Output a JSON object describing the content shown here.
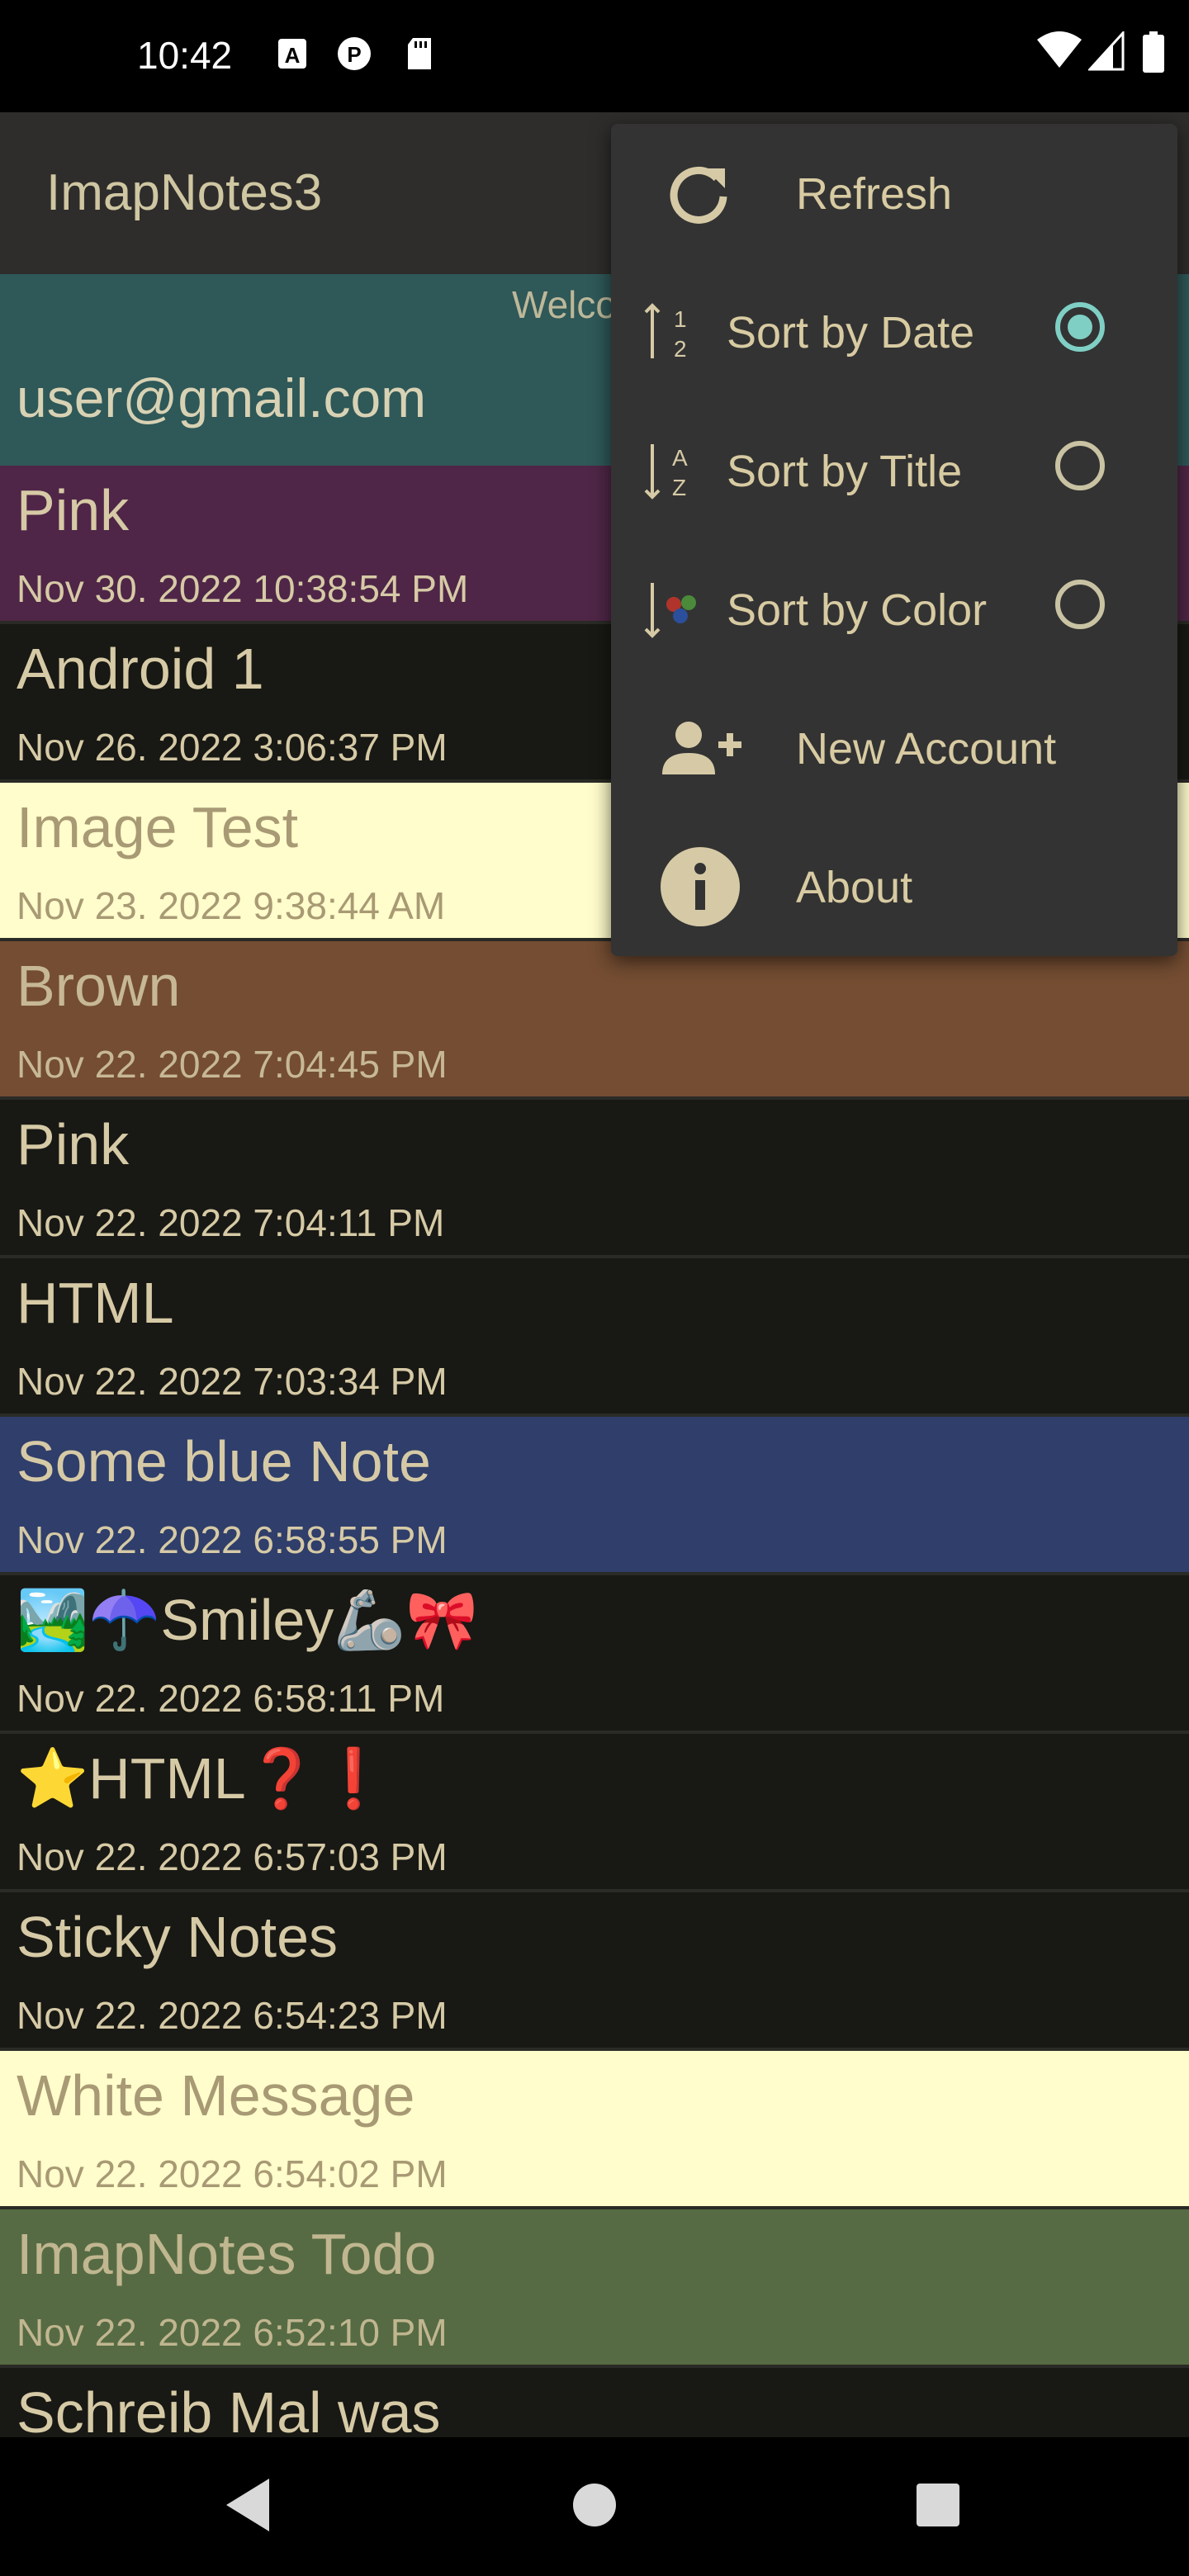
{
  "status_bar": {
    "time": "10:42",
    "icons": [
      "a-icon",
      "p-icon",
      "sd-card-icon"
    ],
    "right_icons": [
      "wifi-icon",
      "signal-icon",
      "battery-icon"
    ]
  },
  "app_bar": {
    "title": "ImapNotes3"
  },
  "account": {
    "welcome": "Welco",
    "email": "user@gmail.com"
  },
  "notes": [
    {
      "title": "Pink",
      "date": "Nov 30. 2022 10:38:54 PM",
      "bg": "#4f2647",
      "color": "#d6caa6"
    },
    {
      "title": "Android 1",
      "date": "Nov 26. 2022 3:06:37 PM",
      "bg": "#181814",
      "color": "#d6caa6"
    },
    {
      "title": "Image Test",
      "date": "Nov 23. 2022 9:38:44 AM",
      "bg": "#fffdcb",
      "color": "#a89a74"
    },
    {
      "title": "Brown",
      "date": "Nov 22. 2022 7:04:45 PM",
      "bg": "#744d32",
      "color": "#c7b895"
    },
    {
      "title": "Pink",
      "date": "Nov 22. 2022 7:04:11 PM",
      "bg": "#181814",
      "color": "#d6caa6"
    },
    {
      "title": "HTML",
      "date": "Nov 22. 2022 7:03:34 PM",
      "bg": "#181814",
      "color": "#d6caa6"
    },
    {
      "title": "Some blue Note",
      "date": "Nov 22. 2022 6:58:55 PM",
      "bg": "#2f3e6a",
      "color": "#d6caa6"
    },
    {
      "title": "🏞️☂️Smiley🦾🎀",
      "date": "Nov 22. 2022 6:58:11 PM",
      "bg": "#181814",
      "color": "#d6caa6"
    },
    {
      "title": "⭐HTML❓❗",
      "date": "Nov 22. 2022 6:57:03 PM",
      "bg": "#181814",
      "color": "#d6caa6"
    },
    {
      "title": "Sticky Notes",
      "date": "Nov 22. 2022 6:54:23 PM",
      "bg": "#181814",
      "color": "#d6caa6"
    },
    {
      "title": "White Message",
      "date": "Nov 22. 2022 6:54:02 PM",
      "bg": "#fffdcb",
      "color": "#a89a74"
    },
    {
      "title": "ImapNotes Todo",
      "date": "Nov 22. 2022 6:52:10 PM",
      "bg": "#566b43",
      "color": "#c0b690"
    },
    {
      "title": "Schreib Mal was",
      "date": "",
      "bg": "#181814",
      "color": "#d6caa6"
    }
  ],
  "menu": {
    "items": [
      {
        "label": "Refresh",
        "icon": "refresh-icon"
      },
      {
        "label": "Sort by Date",
        "icon": "sort-date-icon",
        "radio": true,
        "checked": true
      },
      {
        "label": "Sort by Title",
        "icon": "sort-title-icon",
        "radio": true,
        "checked": false
      },
      {
        "label": "Sort by Color",
        "icon": "sort-color-icon",
        "radio": true,
        "checked": false
      },
      {
        "label": "New Account",
        "icon": "add-person-icon"
      },
      {
        "label": "About",
        "icon": "info-icon"
      }
    ]
  },
  "nav_bar": {
    "buttons": [
      "back-icon",
      "home-icon",
      "recents-icon"
    ]
  },
  "colors": {
    "accent": "#7fcfc4",
    "menu_bg": "#333333",
    "app_bar": "#2e2d2b",
    "account_bg": "#2f5858"
  }
}
